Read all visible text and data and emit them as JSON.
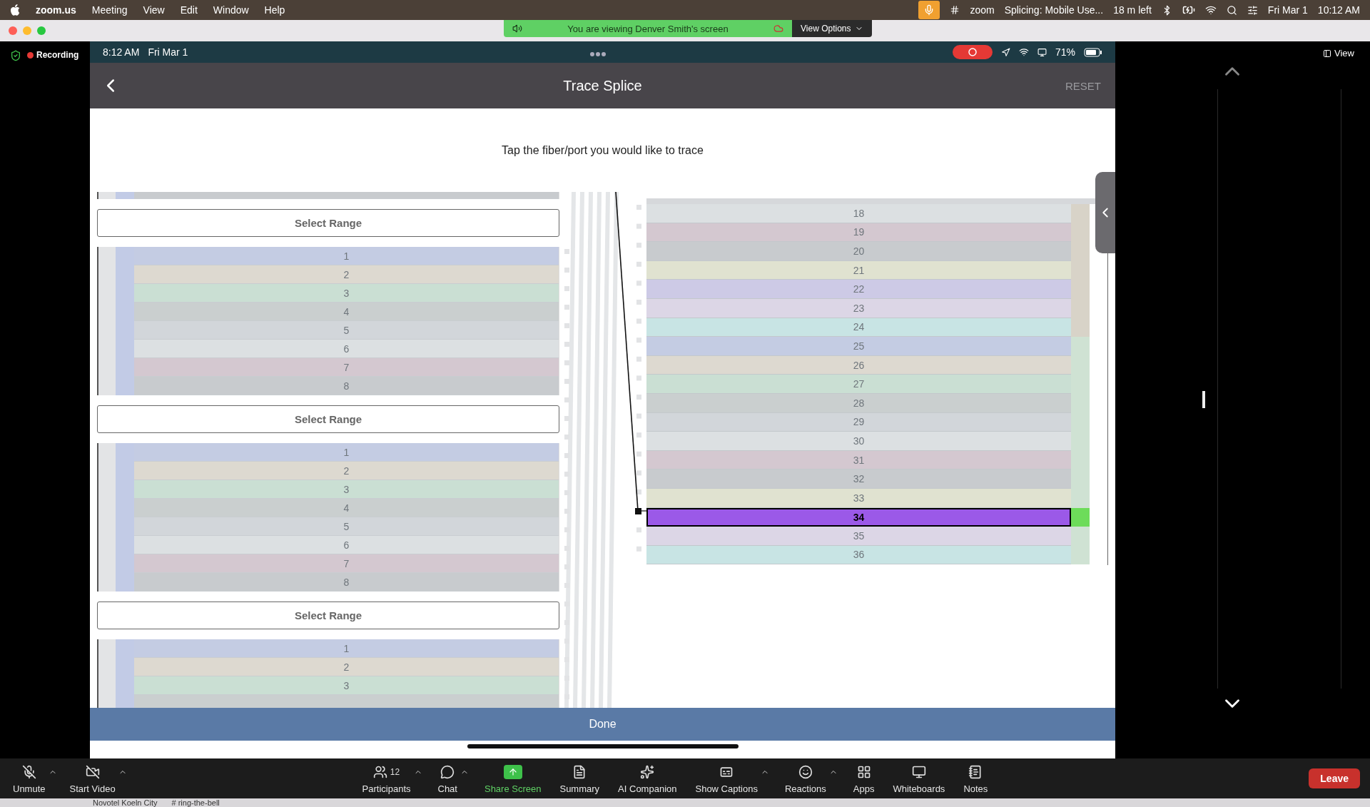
{
  "menu_bar": {
    "app_name": "zoom.us",
    "menus": [
      "Meeting",
      "View",
      "Edit",
      "Window",
      "Help"
    ],
    "zoom_label": "zoom",
    "meeting_title": "Splicing: Mobile Use...",
    "time_left": "18 m left",
    "date": "Fri Mar 1",
    "time": "10:12 AM"
  },
  "title_bar": {
    "banner": "You are viewing Denver Smith's screen",
    "view_options": "View Options"
  },
  "recording": {
    "label": "Recording"
  },
  "shared_screen": {
    "status_bar": {
      "time": "8:12 AM",
      "date": "Fri Mar 1",
      "battery": "71%"
    },
    "nav": {
      "title": "Trace Splice",
      "reset": "RESET"
    },
    "instruction": "Tap the fiber/port you would like to trace",
    "left_items": [
      {
        "kind": "fibers",
        "rows": [
          {
            "color": "#c8cbce"
          }
        ]
      },
      {
        "kind": "button",
        "label": "Select Range"
      },
      {
        "kind": "fibers",
        "rows": [
          {
            "label": "1",
            "color": "#c4cce3"
          },
          {
            "label": "2",
            "color": "#ddd9d0"
          },
          {
            "label": "3",
            "color": "#cadfd3"
          },
          {
            "label": "4",
            "color": "#cacfcf"
          },
          {
            "label": "5",
            "color": "#d2d6da"
          },
          {
            "label": "6",
            "color": "#dce0e2"
          },
          {
            "label": "7",
            "color": "#d4c8d0"
          },
          {
            "label": "8",
            "color": "#c8cbce"
          }
        ]
      },
      {
        "kind": "button",
        "label": "Select Range"
      },
      {
        "kind": "fibers",
        "rows": [
          {
            "label": "1",
            "color": "#c4cce3"
          },
          {
            "label": "2",
            "color": "#ddd9d0"
          },
          {
            "label": "3",
            "color": "#cadfd3"
          },
          {
            "label": "4",
            "color": "#cacfcf"
          },
          {
            "label": "5",
            "color": "#d2d6da"
          },
          {
            "label": "6",
            "color": "#dce0e2"
          },
          {
            "label": "7",
            "color": "#d4c8d0"
          },
          {
            "label": "8",
            "color": "#c8cbce"
          }
        ]
      },
      {
        "kind": "button",
        "label": "Select Range"
      },
      {
        "kind": "fibers",
        "rows": [
          {
            "label": "1",
            "color": "#c4cce3"
          },
          {
            "label": "2",
            "color": "#ddd9d0"
          },
          {
            "label": "3",
            "color": "#cadfd3"
          },
          {
            "color": "#cacfcf"
          }
        ]
      }
    ],
    "right_rows": [
      {
        "label": "18",
        "color": "#dce0e2",
        "selected": false,
        "tube": {
          "color": "#d8d3c8"
        }
      },
      {
        "label": "19",
        "color": "#d4c8d0",
        "selected": false,
        "tube": {
          "color": "#d8d3c8"
        }
      },
      {
        "label": "20",
        "color": "#c8cbce",
        "selected": false,
        "tube": {
          "color": "#d8d3c8"
        }
      },
      {
        "label": "21",
        "color": "#e0e2d0",
        "selected": false,
        "tube": {
          "color": "#d8d3c8"
        }
      },
      {
        "label": "22",
        "color": "#cdcae6",
        "selected": false,
        "tube": {
          "color": "#d8d3c8"
        }
      },
      {
        "label": "23",
        "color": "#dcd6e6",
        "selected": false,
        "tube": {
          "color": "#d8d3c8"
        }
      },
      {
        "label": "24",
        "color": "#c8e4e4",
        "selected": false,
        "tube": {
          "color": "#d8d3c8"
        }
      },
      {
        "label": "25",
        "color": "#c4cce3",
        "selected": false,
        "tube": {
          "color": "#cfe2d3"
        }
      },
      {
        "label": "26",
        "color": "#ddd9d0",
        "selected": false,
        "tube": {
          "color": "#cfe2d3"
        }
      },
      {
        "label": "27",
        "color": "#cadfd3",
        "selected": false,
        "tube": {
          "color": "#cfe2d3"
        }
      },
      {
        "label": "28",
        "color": "#cacfcf",
        "selected": false,
        "tube": {
          "color": "#cfe2d3"
        }
      },
      {
        "label": "29",
        "color": "#d2d6da",
        "selected": false,
        "tube": {
          "color": "#cfe2d3"
        }
      },
      {
        "label": "30",
        "color": "#dce0e2",
        "selected": false,
        "tube": {
          "color": "#cfe2d3"
        }
      },
      {
        "label": "31",
        "color": "#d4c8d0",
        "selected": false,
        "tube": {
          "color": "#cfe2d3"
        }
      },
      {
        "label": "32",
        "color": "#c8cbce",
        "selected": false,
        "tube": {
          "color": "#cfe2d3"
        }
      },
      {
        "label": "33",
        "color": "#e0e2d0",
        "selected": false,
        "tube": {
          "color": "#cfe2d3"
        }
      },
      {
        "label": "34",
        "color": "#9b59e8",
        "selected": true,
        "tube": {
          "color": "#6ddc5a"
        }
      },
      {
        "label": "35",
        "color": "#dcd6e6",
        "selected": false,
        "tube": {
          "color": "#cfe2d3"
        }
      },
      {
        "label": "36",
        "color": "#c8e4e4",
        "selected": false,
        "tube": {
          "color": "#cfe2d3"
        }
      }
    ],
    "done": "Done"
  },
  "right_panel": {
    "view": "View"
  },
  "toolbar": {
    "left": [
      {
        "label": "Unmute",
        "caret": true
      },
      {
        "label": "Start Video",
        "caret": true
      }
    ],
    "center": [
      {
        "label": "Participants",
        "count": "12",
        "caret": true,
        "highlight": false
      },
      {
        "label": "Chat",
        "caret": true,
        "highlight": false
      },
      {
        "label": "Share Screen",
        "caret": false,
        "highlight": true
      },
      {
        "label": "Summary",
        "caret": false,
        "highlight": false
      },
      {
        "label": "AI Companion",
        "caret": false,
        "highlight": false
      },
      {
        "label": "Show Captions",
        "caret": true,
        "highlight": false
      },
      {
        "label": "Reactions",
        "caret": true,
        "highlight": false
      },
      {
        "label": "Apps",
        "caret": false,
        "highlight": false
      },
      {
        "label": "Whiteboards",
        "caret": false,
        "highlight": false
      },
      {
        "label": "Notes",
        "caret": false,
        "highlight": false
      }
    ],
    "leave": "Leave"
  },
  "behind_window": {
    "hotel": "Novotel Koeln City",
    "channel_mark": "#",
    "channel": "ring-the-bell"
  }
}
